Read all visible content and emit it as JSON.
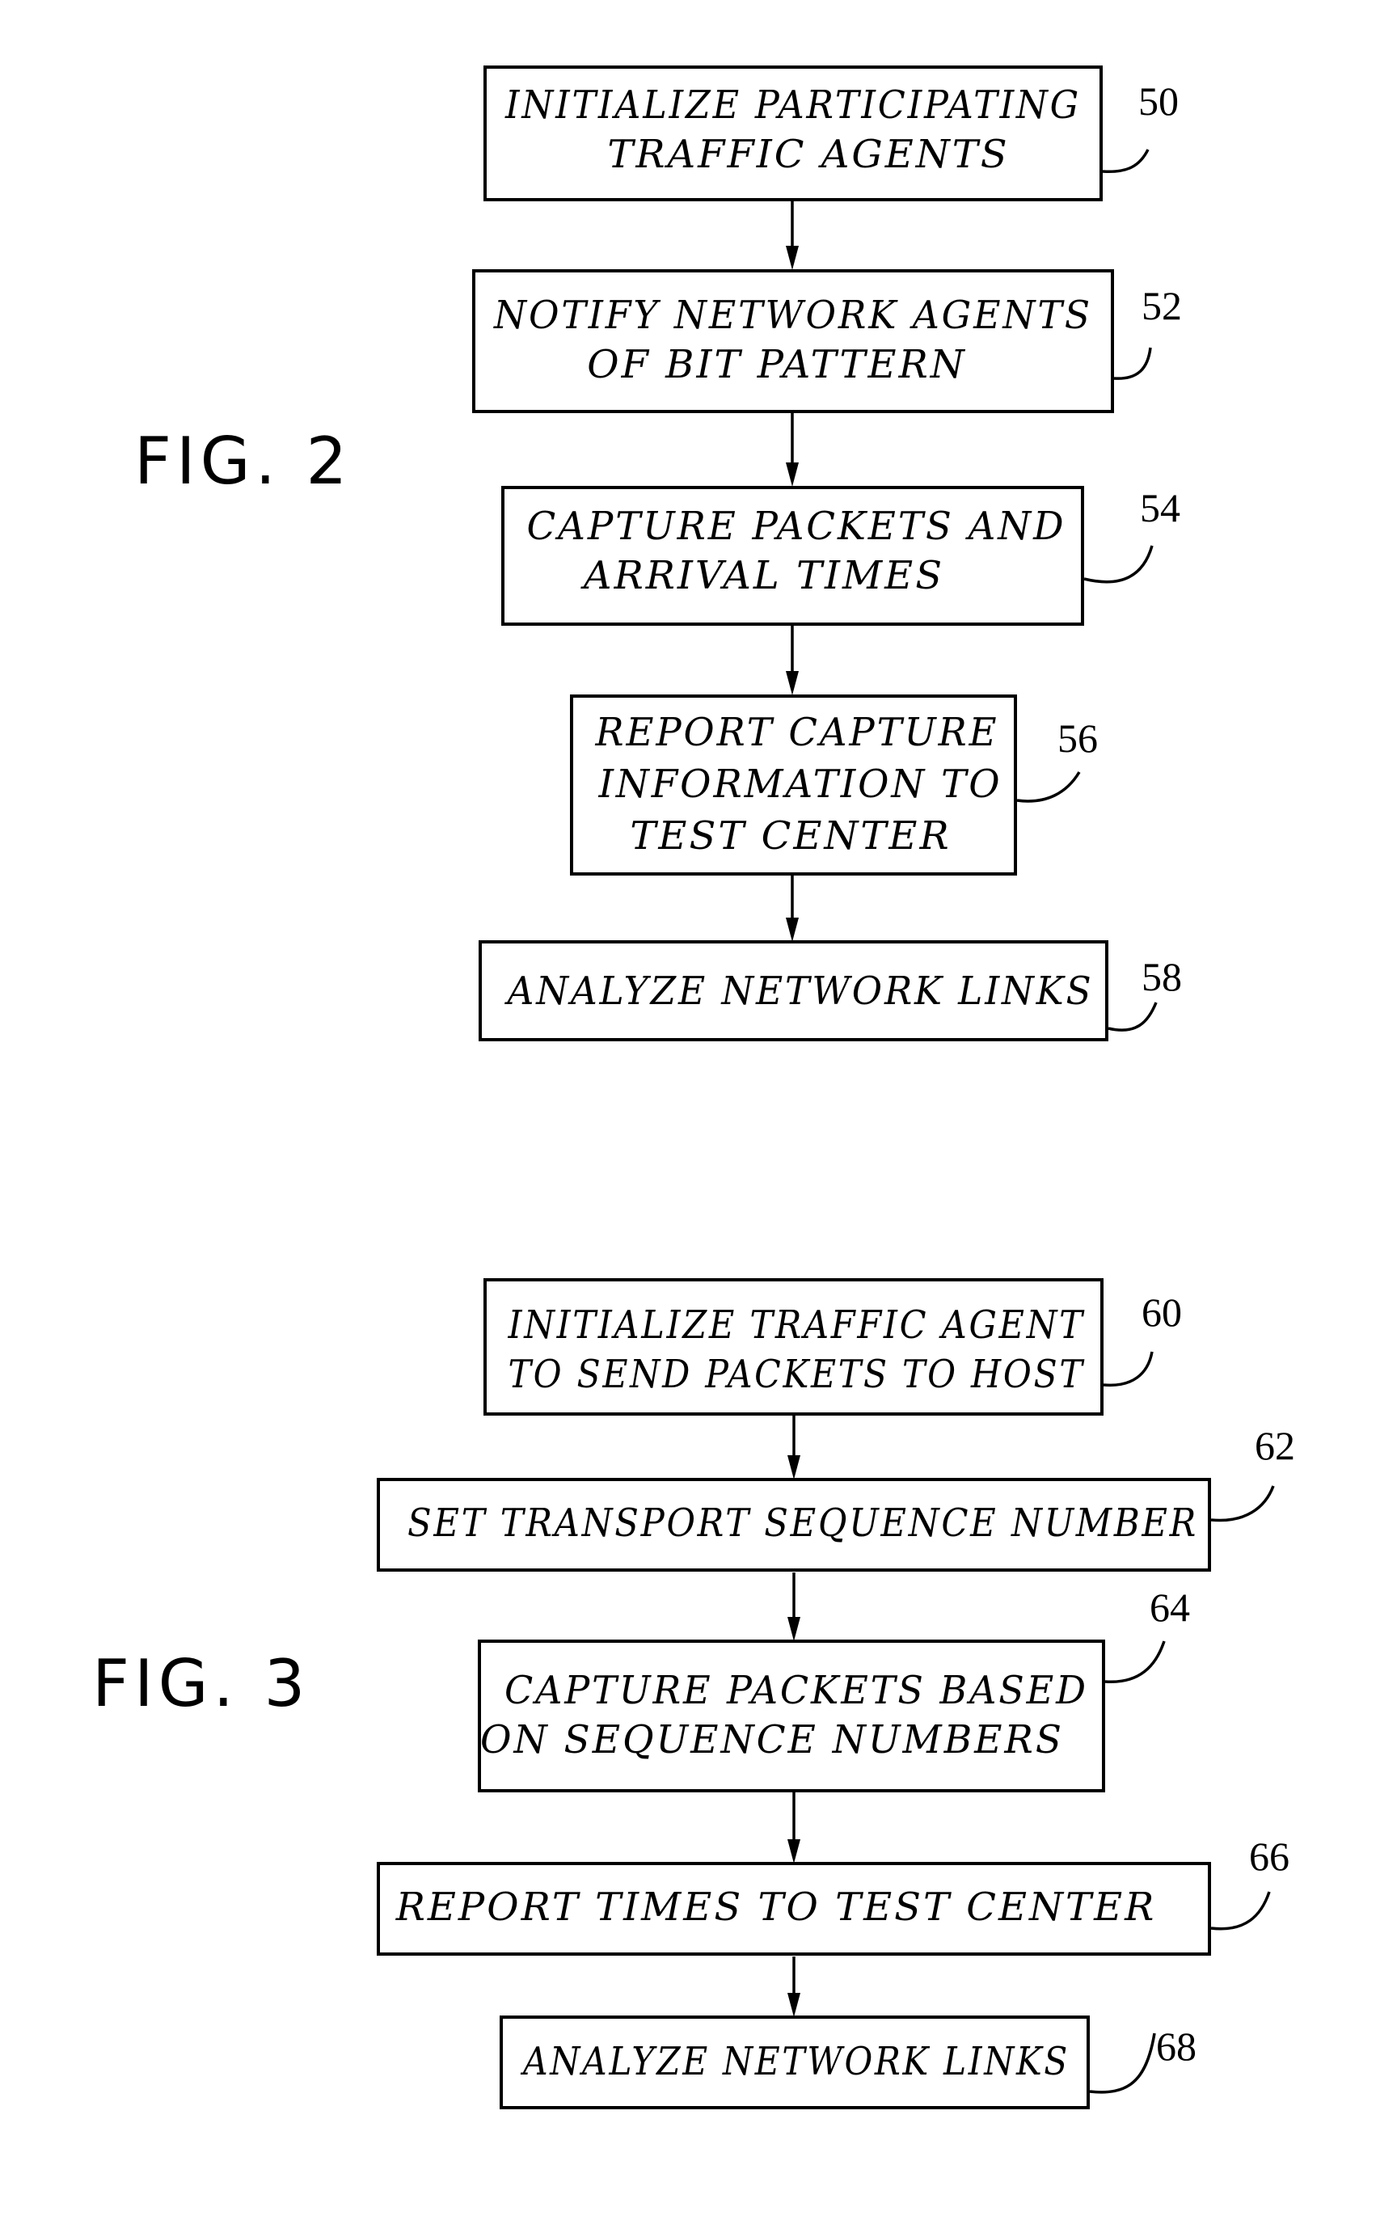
{
  "figures": [
    {
      "label": "FIG. 2",
      "steps": [
        {
          "ref": "50",
          "lines": [
            "INITIALIZE PARTICIPATING",
            "TRAFFIC AGENTS"
          ]
        },
        {
          "ref": "52",
          "lines": [
            "NOTIFY NETWORK AGENTS",
            "OF BIT PATTERN"
          ]
        },
        {
          "ref": "54",
          "lines": [
            "CAPTURE PACKETS AND",
            "ARRIVAL TIMES"
          ]
        },
        {
          "ref": "56",
          "lines": [
            "REPORT CAPTURE",
            "INFORMATION TO",
            "TEST CENTER"
          ]
        },
        {
          "ref": "58",
          "lines": [
            "ANALYZE NETWORK LINKS"
          ]
        }
      ]
    },
    {
      "label": "FIG. 3",
      "steps": [
        {
          "ref": "60",
          "lines": [
            "INITIALIZE TRAFFIC AGENT",
            "TO SEND PACKETS TO HOST"
          ]
        },
        {
          "ref": "62",
          "lines": [
            "SET TRANSPORT SEQUENCE NUMBER"
          ]
        },
        {
          "ref": "64",
          "lines": [
            "CAPTURE PACKETS BASED",
            "ON SEQUENCE NUMBERS"
          ]
        },
        {
          "ref": "66",
          "lines": [
            "REPORT TIMES TO TEST CENTER"
          ]
        },
        {
          "ref": "68",
          "lines": [
            "ANALYZE NETWORK LINKS"
          ]
        }
      ]
    }
  ]
}
